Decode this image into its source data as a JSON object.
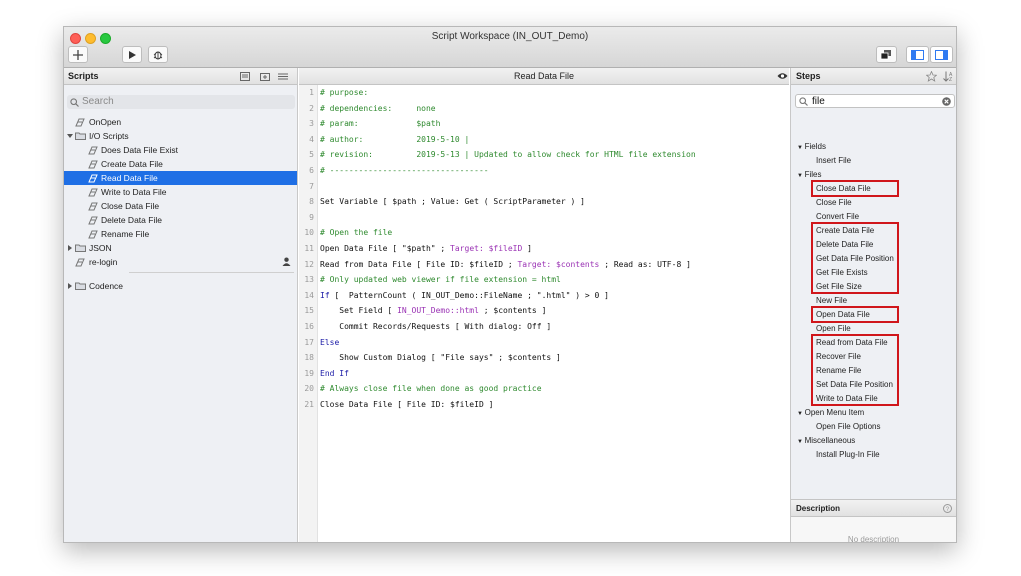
{
  "window": {
    "title": "Script Workspace (IN_OUT_Demo)"
  },
  "scripts": {
    "header": "Scripts",
    "search_placeholder": "Search",
    "items": [
      {
        "label": "OnOpen"
      },
      {
        "label": "I/O Scripts"
      },
      {
        "label": "Does Data File Exist"
      },
      {
        "label": "Create Data File"
      },
      {
        "label": "Read Data File",
        "selected": true
      },
      {
        "label": "Write to Data File"
      },
      {
        "label": "Close Data File"
      },
      {
        "label": "Delete Data File"
      },
      {
        "label": "Rename File"
      },
      {
        "label": "JSON"
      },
      {
        "label": "re-login"
      },
      {
        "label": "Codence"
      }
    ]
  },
  "editor": {
    "title": "Read Data File",
    "lines": [
      {
        "n": "1",
        "parts": [
          {
            "t": "# purpose:",
            "c": "com"
          }
        ]
      },
      {
        "n": "2",
        "parts": [
          {
            "t": "# dependencies:     none",
            "c": "com"
          }
        ]
      },
      {
        "n": "3",
        "parts": [
          {
            "t": "# param:            $path",
            "c": "com"
          }
        ]
      },
      {
        "n": "4",
        "parts": [
          {
            "t": "# author:           2019-5-10 |",
            "c": "com"
          }
        ]
      },
      {
        "n": "5",
        "parts": [
          {
            "t": "# revision:         2019-5-13 | Updated to allow check for HTML file extension",
            "c": "com"
          }
        ]
      },
      {
        "n": "6",
        "parts": [
          {
            "t": "# ---------------------------------",
            "c": "com"
          }
        ]
      },
      {
        "n": "7",
        "parts": []
      },
      {
        "n": "8",
        "parts": [
          {
            "t": "Set Variable [ $path ; Value: Get ( ScriptParameter ) ]",
            "c": "def"
          }
        ]
      },
      {
        "n": "9",
        "parts": []
      },
      {
        "n": "10",
        "parts": [
          {
            "t": "# Open the file",
            "c": "com"
          }
        ]
      },
      {
        "n": "11",
        "parts": [
          {
            "t": "Open Data File [ \"$path\" ; ",
            "c": "def"
          },
          {
            "t": "Target: $fileID",
            "c": "pur"
          },
          {
            "t": " ]",
            "c": "def"
          }
        ]
      },
      {
        "n": "12",
        "parts": [
          {
            "t": "Read from Data File [ File ID: $fileID ; ",
            "c": "def"
          },
          {
            "t": "Target: $contents",
            "c": "pur"
          },
          {
            "t": " ; Read as: UTF-8 ]",
            "c": "def"
          }
        ]
      },
      {
        "n": "13",
        "parts": [
          {
            "t": "# Only updated web viewer if file extension = html",
            "c": "com"
          }
        ]
      },
      {
        "n": "14",
        "parts": [
          {
            "t": "If",
            "c": "key"
          },
          {
            "t": " [  PatternCount ( IN_OUT_Demo::FileName ; \".html\" ) > 0 ]",
            "c": "def"
          }
        ]
      },
      {
        "n": "15",
        "parts": [
          {
            "t": "    Set Field [ ",
            "c": "def"
          },
          {
            "t": "IN_OUT_Demo::html",
            "c": "pur"
          },
          {
            "t": " ; $contents ]",
            "c": "def"
          }
        ]
      },
      {
        "n": "16",
        "parts": [
          {
            "t": "    Commit Records/Requests [ With dialog: Off ]",
            "c": "def"
          }
        ]
      },
      {
        "n": "17",
        "parts": [
          {
            "t": "Else",
            "c": "key"
          }
        ]
      },
      {
        "n": "18",
        "parts": [
          {
            "t": "    Show Custom Dialog [ \"File says\" ; $contents ]",
            "c": "def"
          }
        ]
      },
      {
        "n": "19",
        "parts": [
          {
            "t": "End If",
            "c": "key"
          }
        ]
      },
      {
        "n": "20",
        "parts": [
          {
            "t": "# Always close file when done as good practice",
            "c": "com"
          }
        ]
      },
      {
        "n": "21",
        "parts": [
          {
            "t": "Close Data File [ File ID: $fileID ]",
            "c": "def"
          }
        ]
      }
    ]
  },
  "steps": {
    "header": "Steps",
    "search_value": "file",
    "items": [
      {
        "label": "Fields",
        "kind": "cat"
      },
      {
        "label": "Insert File",
        "kind": "leaf"
      },
      {
        "label": "Files",
        "kind": "cat"
      },
      {
        "label": "Close Data File",
        "kind": "leaf"
      },
      {
        "label": "Close File",
        "kind": "leaf"
      },
      {
        "label": "Convert File",
        "kind": "leaf"
      },
      {
        "label": "Create Data File",
        "kind": "leaf"
      },
      {
        "label": "Delete Data File",
        "kind": "leaf"
      },
      {
        "label": "Get Data File Position",
        "kind": "leaf"
      },
      {
        "label": "Get File Exists",
        "kind": "leaf"
      },
      {
        "label": "Get File Size",
        "kind": "leaf"
      },
      {
        "label": "New File",
        "kind": "leaf"
      },
      {
        "label": "Open Data File",
        "kind": "leaf"
      },
      {
        "label": "Open File",
        "kind": "leaf"
      },
      {
        "label": "Read from Data File",
        "kind": "leaf"
      },
      {
        "label": "Recover File",
        "kind": "leaf"
      },
      {
        "label": "Rename File",
        "kind": "leaf"
      },
      {
        "label": "Set Data File Position",
        "kind": "leaf"
      },
      {
        "label": "Write to Data File",
        "kind": "leaf"
      },
      {
        "label": "Open Menu Item",
        "kind": "cat"
      },
      {
        "label": "Open File Options",
        "kind": "leaf"
      },
      {
        "label": "Miscellaneous",
        "kind": "cat"
      },
      {
        "label": "Install Plug-In File",
        "kind": "leaf"
      }
    ],
    "description_header": "Description",
    "description_text": "No description"
  }
}
